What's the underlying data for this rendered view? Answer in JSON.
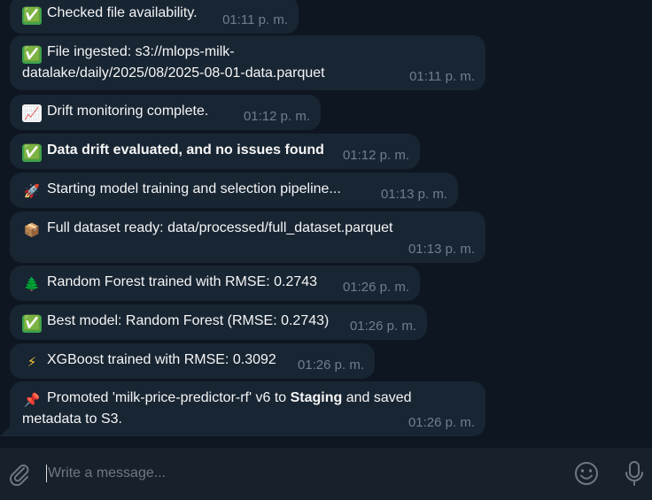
{
  "messages": [
    {
      "emoji": "✅",
      "text": "Checked file availability.",
      "time": "01:11 p. m."
    },
    {
      "emoji": "✅",
      "text": "File ingested: s3://mlops-milk-datalake/daily/2025/08/2025-08-01-data.parquet",
      "line1": "File ingested: s3://mlops-milk-",
      "line2": "datalake/daily/2025/08/2025-08-01-data.parquet",
      "time": "01:11 p. m."
    },
    {
      "emoji": "📈",
      "text": "Drift monitoring complete.",
      "time": "01:12 p. m."
    },
    {
      "emoji": "✅",
      "text": "Data drift evaluated, and no issues found",
      "time": "01:12 p. m."
    },
    {
      "emoji": "🚀",
      "text": "Starting model training and selection pipeline...",
      "time": "01:13 p. m."
    },
    {
      "emoji": "📦",
      "text": "Full dataset ready: data/processed/full_dataset.parquet",
      "time": "01:13 p. m."
    },
    {
      "emoji": "🌲",
      "text": "Random Forest trained with RMSE: 0.2743",
      "time": "01:26 p. m."
    },
    {
      "emoji": "✅",
      "text": "Best model: Random Forest (RMSE: 0.2743)",
      "time": "01:26 p. m."
    },
    {
      "emoji": "⚡",
      "text": "XGBoost trained with RMSE: 0.3092",
      "time": "01:26 p. m."
    },
    {
      "emoji": "📌",
      "text_before": "Promoted 'milk-price-predictor-rf' v6 to ",
      "text_bold": "Staging",
      "text_after": " and saved",
      "line2": "metadata to S3.",
      "time": "01:26 p. m."
    }
  ],
  "composer": {
    "placeholder": "Write a message..."
  },
  "colors": {
    "background": "#0e1621",
    "bubble": "#182533",
    "composer": "#17212b",
    "timestamp": "#6d7f8f",
    "text": "#f5f5f5"
  },
  "icons": {
    "attach": "paperclip-icon",
    "emoji": "smiley-icon",
    "voice": "microphone-icon"
  }
}
